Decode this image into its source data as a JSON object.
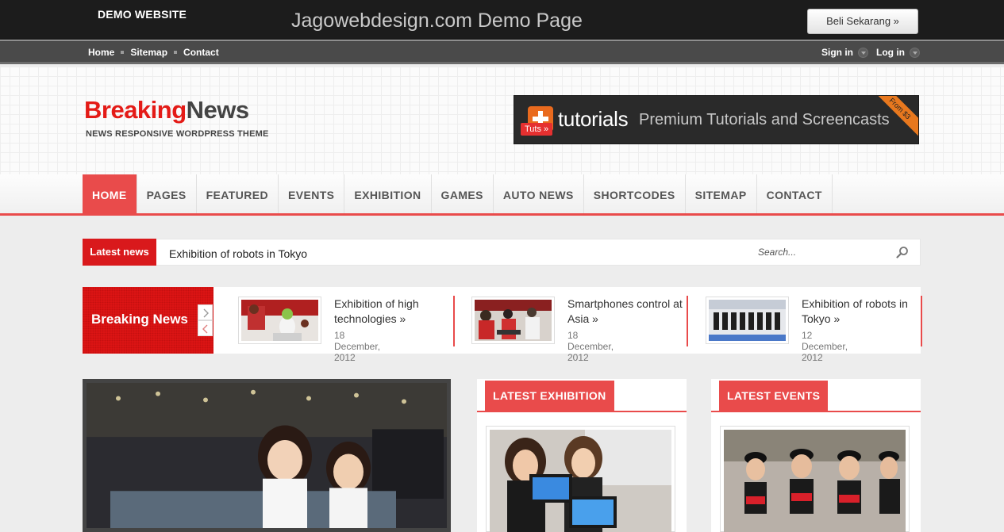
{
  "demo_bar": {
    "label": "DEMO WEBSITE",
    "title": "Jagowebdesign.com Demo Page",
    "buy_button": "Beli Sekarang »"
  },
  "top_nav": {
    "links": [
      "Home",
      "Sitemap",
      "Contact"
    ],
    "sign_in": "Sign in",
    "log_in": "Log in"
  },
  "header": {
    "logo_part1": "Breaking",
    "logo_part2": "News",
    "tagline": "NEWS RESPONSIVE WORDPRESS THEME",
    "banner": {
      "tag": "Tuts »",
      "brand": "tutorials",
      "text": "Premium Tutorials and Screencasts",
      "corner": "From $3"
    }
  },
  "main_nav": {
    "items": [
      "HOME",
      "PAGES",
      "FEATURED",
      "EVENTS",
      "EXHIBITION",
      "GAMES",
      "AUTO NEWS",
      "SHORTCODES",
      "SITEMAP",
      "CONTACT"
    ],
    "active": "HOME"
  },
  "ticker": {
    "label": "Latest news",
    "headline": "Exhibition of robots in Tokyo",
    "search_placeholder": "Search..."
  },
  "breaking": {
    "title": "Breaking News",
    "items": [
      {
        "title": "Exhibition of high technologies »",
        "date": "18 December, 2012"
      },
      {
        "title": "Smartphones control at Asia »",
        "date": "18 December, 2012"
      },
      {
        "title": "Exhibition of robots in Tokyo »",
        "date": "12 December, 2012"
      }
    ]
  },
  "panels": {
    "exhibition": "LATEST EXHIBITION",
    "events": "LATEST EVENTS"
  },
  "colors": {
    "accent": "#e94b4b",
    "brand_red": "#e41b17",
    "dark_bar": "#1c1c1c"
  }
}
